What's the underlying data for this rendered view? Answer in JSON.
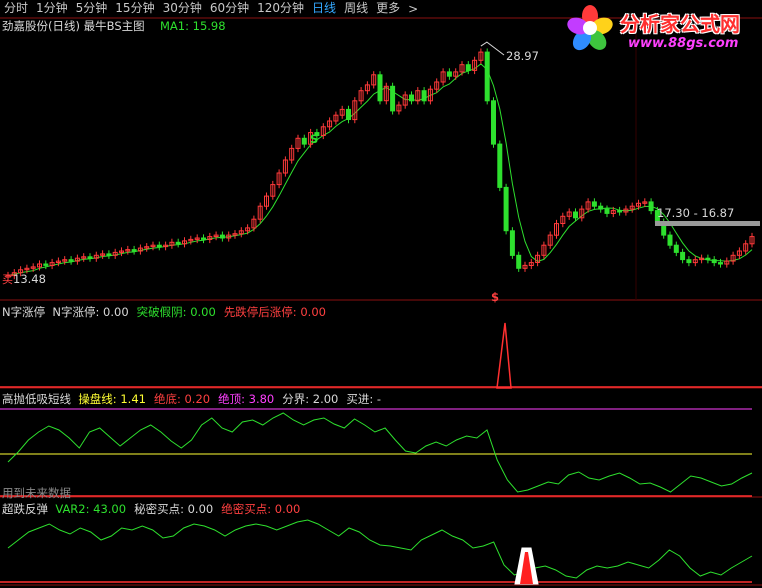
{
  "toolbar": {
    "tabs": [
      "分时",
      "1分钟",
      "5分钟",
      "15分钟",
      "30分钟",
      "60分钟",
      "120分钟",
      "日线",
      "周线",
      "更多"
    ],
    "active_index": 7,
    "more_chevron": ">"
  },
  "logo": {
    "title": "分析家公式网",
    "url": "www.88gs.com"
  },
  "main_panel": {
    "title": "劲嘉股份(日线) 最牛BS主图",
    "ma_label": "MA1: 15.98",
    "high_label": "28.97",
    "low_label": "13.48",
    "range_label": "17.30 - 16.87",
    "buy_marker_low": "买",
    "signal_s": "S",
    "signal_s2": "S",
    "signal_buy": "$"
  },
  "panel2": {
    "name": "N字涨停",
    "items": [
      {
        "label": "N字涨停: 0.00",
        "color": "#d8d8d8"
      },
      {
        "label": "突破假阴: 0.00",
        "color": "#2ee02e"
      },
      {
        "label": "先跌停后涨停: 0.00",
        "color": "#ff4040"
      }
    ]
  },
  "panel3": {
    "name": "高抛低吸短线",
    "items": [
      {
        "label": "操盘线: 1.41",
        "color": "#ffff33"
      },
      {
        "label": "绝底: 0.20",
        "color": "#ff4040"
      },
      {
        "label": "绝顶: 3.80",
        "color": "#ff40ff"
      },
      {
        "label": "分界: 2.00",
        "color": "#d8d8d8"
      },
      {
        "label": "买进: -",
        "color": "#d8d8d8"
      }
    ],
    "note": "用到未来数据"
  },
  "panel4": {
    "name": "超跌反弹",
    "items": [
      {
        "label": "VAR2: 43.00",
        "color": "#2ee02e"
      },
      {
        "label": "秘密买点: 0.00",
        "color": "#d8d8d8"
      },
      {
        "label": "绝密买点: 0.00",
        "color": "#ff4040"
      }
    ]
  },
  "chart_data": [
    {
      "type": "candlestick",
      "title": "劲嘉股份(日线) 最牛BS主图",
      "series": [
        {
          "name": "MA1",
          "last": 15.98
        }
      ],
      "annotations": {
        "high": 28.97,
        "low": 13.48,
        "range": "17.30 - 16.87"
      },
      "close": [
        13.5,
        13.7,
        13.9,
        14.0,
        14.1,
        14.3,
        14.2,
        14.4,
        14.5,
        14.6,
        14.5,
        14.7,
        14.8,
        14.7,
        14.9,
        15.0,
        14.9,
        15.1,
        15.2,
        15.3,
        15.2,
        15.4,
        15.5,
        15.6,
        15.5,
        15.6,
        15.8,
        15.7,
        15.9,
        16.0,
        16.1,
        16.0,
        16.2,
        16.3,
        16.1,
        16.3,
        16.4,
        16.6,
        16.8,
        17.4,
        18.3,
        19.0,
        19.8,
        20.6,
        21.5,
        22.3,
        23.0,
        22.6,
        23.4,
        23.2,
        23.8,
        24.2,
        24.6,
        25.0,
        24.3,
        25.6,
        26.3,
        26.7,
        27.4,
        25.6,
        26.6,
        24.9,
        25.3,
        26.0,
        25.6,
        26.3,
        25.6,
        26.4,
        26.9,
        27.6,
        27.3,
        27.6,
        28.1,
        27.7,
        28.4,
        28.97,
        25.6,
        22.6,
        19.6,
        16.6,
        14.9,
        14.0,
        14.2,
        14.4,
        14.9,
        15.6,
        16.3,
        17.1,
        17.6,
        17.9,
        17.5,
        18.1,
        18.6,
        18.3,
        18.1,
        17.8,
        18.0,
        17.9,
        18.1,
        18.3,
        18.5,
        18.6,
        18.0,
        17.2,
        16.3,
        15.6,
        15.1,
        14.6,
        14.4,
        14.6,
        14.7,
        14.6,
        14.4,
        14.3,
        14.5,
        14.9,
        15.2,
        15.7,
        16.2
      ]
    },
    {
      "type": "line",
      "title": "N字涨停",
      "series": [
        {
          "name": "N字涨停",
          "last": 0.0
        },
        {
          "name": "突破假阴",
          "last": 0.0
        },
        {
          "name": "先跌停后涨停",
          "last": 0.0
        }
      ]
    },
    {
      "type": "line",
      "title": "高抛低吸短线",
      "series": [
        {
          "name": "操盘线",
          "last": 1.41
        },
        {
          "name": "绝底",
          "last": 0.2
        },
        {
          "name": "绝顶",
          "last": 3.8
        },
        {
          "name": "分界",
          "last": 2.0
        }
      ]
    },
    {
      "type": "line",
      "title": "超跌反弹",
      "series": [
        {
          "name": "VAR2",
          "last": 43.0
        },
        {
          "name": "秘密买点",
          "last": 0.0
        },
        {
          "name": "绝密买点",
          "last": 0.0
        }
      ]
    }
  ]
}
